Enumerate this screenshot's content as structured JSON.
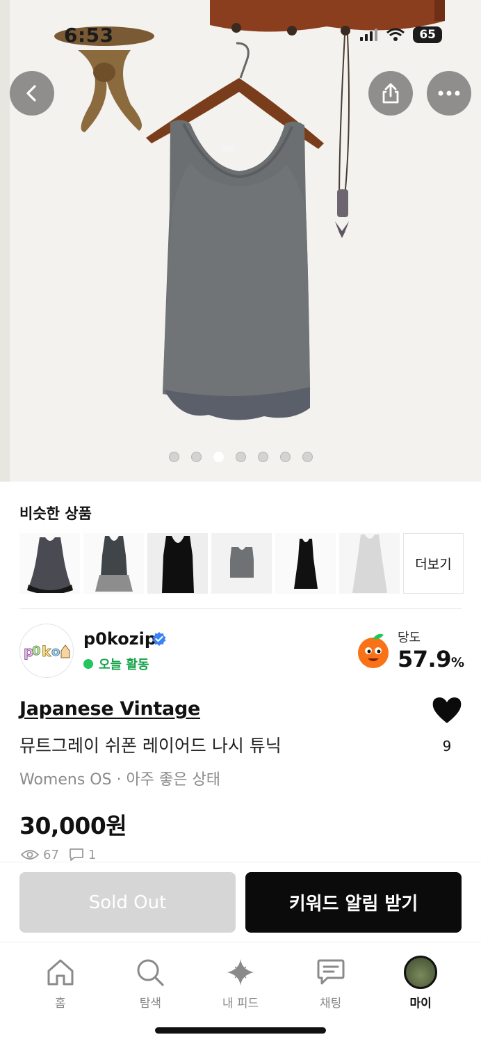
{
  "status_bar": {
    "time": "6:53",
    "battery": "65"
  },
  "hero": {
    "page_count": 7,
    "active_index": 2
  },
  "similar": {
    "title": "비슷한 상품",
    "more_label": "더보기",
    "items": [
      {
        "name": "similar-item-1"
      },
      {
        "name": "similar-item-2"
      },
      {
        "name": "similar-item-3"
      },
      {
        "name": "similar-item-4"
      },
      {
        "name": "similar-item-5"
      },
      {
        "name": "similar-item-6"
      }
    ]
  },
  "seller": {
    "name": "p0kozip",
    "activity": "오늘 활동",
    "sweetness_label": "당도",
    "sweetness_value": "57.9",
    "sweetness_unit": "%"
  },
  "product": {
    "brand": "Japanese Vintage",
    "title": "뮤트그레이 쉬폰 레이어드 나시 튜닉",
    "meta": "Womens OS · 아주 좋은 상태",
    "price": "30,000원",
    "views": "67",
    "comments": "1",
    "likes": "9"
  },
  "actions": {
    "sold_out": "Sold Out",
    "keyword_alert": "키워드 알림 받기"
  },
  "tabs": [
    {
      "label": "홈",
      "icon": "home-icon"
    },
    {
      "label": "탐색",
      "icon": "search-icon"
    },
    {
      "label": "내 피드",
      "icon": "sparkle-icon"
    },
    {
      "label": "채팅",
      "icon": "chat-icon"
    },
    {
      "label": "마이",
      "icon": "profile-icon"
    }
  ],
  "colors": {
    "accent": "#0b0b0b",
    "active_green": "#22c55e",
    "soldout_gray": "#d6d6d6"
  }
}
